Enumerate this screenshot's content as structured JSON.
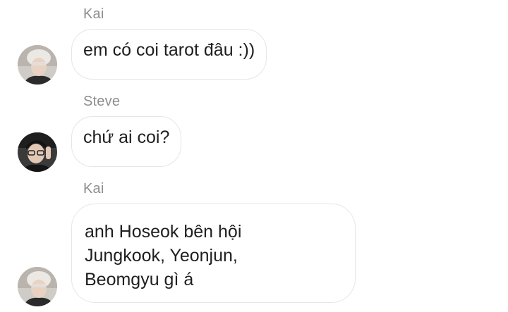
{
  "messages": [
    {
      "sender": "Kai",
      "text": "em có coi tarot đâu :))"
    },
    {
      "sender": "Steve",
      "text": "chứ ai coi?"
    },
    {
      "sender": "Kai",
      "lines": [
        "anh Hoseok bên hội",
        "Jungkook, Yeonjun,",
        "Beomgyu gì á"
      ]
    }
  ]
}
